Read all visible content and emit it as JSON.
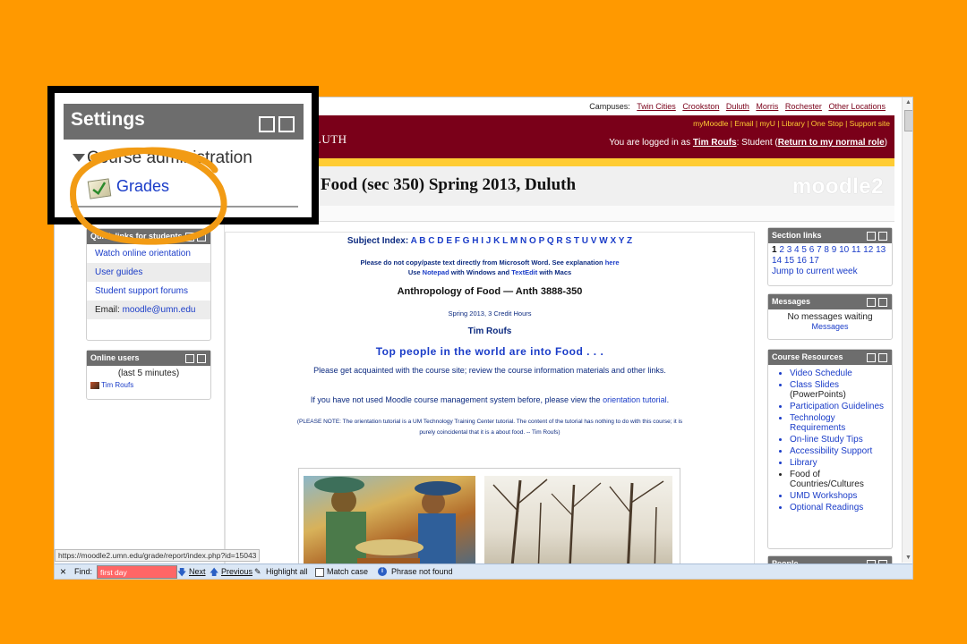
{
  "campus_bar": {
    "label": "Campuses:",
    "links": [
      "Twin Cities",
      "Crookston",
      "Duluth",
      "Morris",
      "Rochester",
      "Other Locations"
    ]
  },
  "header": {
    "top_links": "myMoodle | Email | myU | Library | One Stop | Support site",
    "logged_prefix": "You are logged in as",
    "user_name": "Tim Roufs",
    "logged_role": ": Student (",
    "return_link": "Return to my normal role",
    "logged_suffix": ")",
    "duluth_fragment": "ULUTH",
    "course_title": "Food (sec 350) Spring 2013, Duluth",
    "brand": "moodle2"
  },
  "settings_callout": {
    "title": "Settings",
    "section": "Course administration",
    "grades_link": "Grades"
  },
  "quick_links": {
    "title": "Quick links for students",
    "items": [
      "Watch online orientation",
      "User guides",
      "Student support forums"
    ],
    "email_label": "Email:",
    "email_value": "moodle@umn.edu"
  },
  "online_users": {
    "title": "Online users",
    "subtitle": "(last 5 minutes)",
    "user": "Tim Roufs"
  },
  "center": {
    "subject_label": "Subject Index:",
    "letters": [
      "A",
      "B",
      "C",
      "D",
      "E",
      "F",
      "G",
      "H",
      "I",
      "J",
      "K",
      "L",
      "M",
      "N",
      "O",
      "P",
      "Q",
      "R",
      "S",
      "T",
      "U",
      "V",
      "W",
      "X",
      "Y",
      "Z"
    ],
    "copy_warning_1": "Please do not copy/paste text directly from Microsoft Word.  See explanation",
    "here_link": "here",
    "copy_warning_2a": "Use",
    "notepad": "Notepad",
    "copy_warning_2b": "with Windows and",
    "textedit": "TextEdit",
    "copy_warning_2c": "with Macs",
    "course_name": "Anthropology of Food — Anth 3888-350",
    "term": "Spring 2013, 3 Credit Hours",
    "instructor": "Tim Roufs",
    "tagline": "Top people in the world are into Food . . .",
    "acquaint": "Please get acquainted with the course site; review the course information materials and other links.",
    "orientation_pre": "If you have not used Moodle course management system before, please view the",
    "orientation_link": "orientation tutorial",
    "orientation_post": ".",
    "note_1": "(PLEASE NOTE:  The orientation tutorial is a UM Technology Training Center tutorial.  The content of the tutorial has nothing to do with this course; it is",
    "note_2": "purely coincidental that it is a about food.  -- Tim Roufs)"
  },
  "section_links": {
    "title": "Section links",
    "row1": [
      "1",
      "2",
      "3",
      "4",
      "5",
      "6",
      "7",
      "8",
      "9",
      "10",
      "11",
      "12",
      "13"
    ],
    "row2": [
      "14",
      "15",
      "16",
      "17"
    ],
    "jump": "Jump to current week"
  },
  "messages": {
    "title": "Messages",
    "none": "No messages waiting",
    "link": "Messages"
  },
  "course_resources": {
    "title": "Course Resources",
    "items": [
      {
        "text": "Video Schedule",
        "dark": false
      },
      {
        "text": "Class Slides",
        "dark": false
      },
      {
        "text": "(PowerPoints)",
        "dark": true
      },
      {
        "text": "Participation Guidelines",
        "dark": false
      },
      {
        "text": "Technology Requirements",
        "dark": false
      },
      {
        "text": "On-line Study Tips",
        "dark": false
      },
      {
        "text": "Accessibility Support",
        "dark": false
      },
      {
        "text": "Library",
        "dark": false
      },
      {
        "text": "Food of Countries/Cultures",
        "dark": true
      },
      {
        "text": "UMD Workshops",
        "dark": false
      },
      {
        "text": "Optional Readings",
        "dark": false
      }
    ]
  },
  "people_block": {
    "title": "People"
  },
  "status_url": "https://moodle2.umn.edu/grade/report/index.php?id=15043",
  "find_bar": {
    "close": "×",
    "label": "Find:",
    "value": "first day",
    "next": "Next",
    "previous": "Previous",
    "highlight": "Highlight all",
    "match_case": "Match case",
    "result": "Phrase not found"
  },
  "colors": {
    "background": "#ff9900",
    "maroon": "#7a0019",
    "gold": "#ffcc33",
    "link": "#1a3cc8",
    "circle": "#f29b14"
  }
}
